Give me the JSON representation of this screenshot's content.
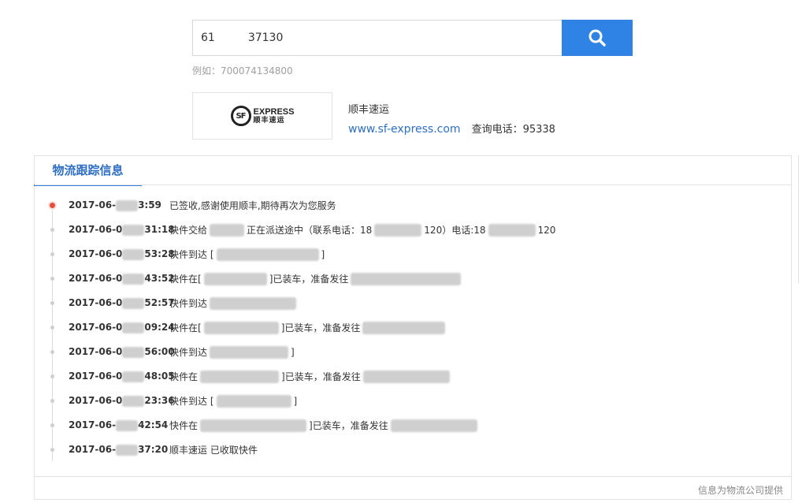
{
  "search": {
    "value": "61   37130",
    "example": "例如：700074134800"
  },
  "company": {
    "logo_en": "EXPRESS",
    "logo_cn": "顺丰速运",
    "logo_mark": "SF",
    "name": "顺丰速运",
    "url": "www.sf-express.com",
    "phone_label": "查询电话：95338"
  },
  "panel": {
    "tab": "物流跟踪信息",
    "footer": "信息为物流公司提供"
  },
  "tracking": [
    {
      "time_a": "2017-06-",
      "time_b": "3:59",
      "desc": "已签收,感谢使用顺丰,期待再次为您服务",
      "blurs": []
    },
    {
      "time_a": "2017-06-0",
      "time_b": "31:18",
      "desc": "快件交给",
      "desc2": "正在派送途中（联系电话：18",
      "desc3": "120）电话:18",
      "desc4": "120",
      "blurs": [
        44,
        60,
        60
      ]
    },
    {
      "time_a": "2017-06-0",
      "time_b": "53:28",
      "desc": "快件到达 [",
      "desc2": "]",
      "blurs": [
        130
      ]
    },
    {
      "time_a": "2017-06-0",
      "time_b": "43:52",
      "desc": "快件在[",
      "desc2": "]已装车，准备发往",
      "blurs": [
        80,
        140
      ]
    },
    {
      "time_a": "2017-06-0",
      "time_b": "52:57",
      "desc": "快件到达",
      "desc2": "",
      "blurs": [
        110
      ]
    },
    {
      "time_a": "2017-06-0",
      "time_b": "09:24",
      "desc": "快件在[",
      "desc2": "]已装车，准备发往",
      "blurs": [
        95,
        105
      ]
    },
    {
      "time_a": "2017-06-0",
      "time_b": "56:00",
      "desc": "快件到达",
      "desc2": "]",
      "blurs": [
        100
      ]
    },
    {
      "time_a": "2017-06-0",
      "time_b": "48:05",
      "desc": "快件在",
      "desc2": "]已装车，准备发往",
      "blurs": [
        100,
        110
      ]
    },
    {
      "time_a": "2017-06-0",
      "time_b": "23:36",
      "desc": "快件到达 [",
      "desc2": "]",
      "blurs": [
        95
      ]
    },
    {
      "time_a": "2017-06-",
      "time_b": "42:54",
      "desc": "快件在",
      "desc2": "]已装车，准备发往",
      "blurs": [
        135,
        110
      ]
    },
    {
      "time_a": "2017-06-",
      "time_b": "37:20",
      "desc": "顺丰速运 已收取快件",
      "blurs": []
    }
  ]
}
